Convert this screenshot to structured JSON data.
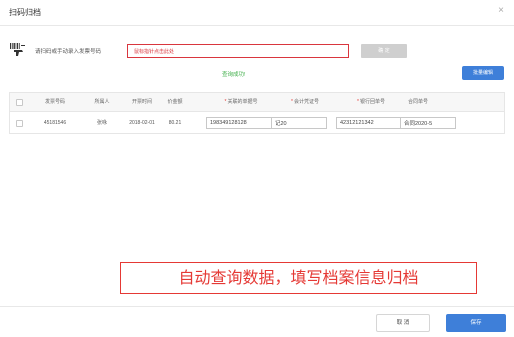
{
  "dialog": {
    "title": "扫码归档",
    "close_glyph": "×"
  },
  "scan": {
    "label": "请扫码或手动录入发票号码",
    "input_value": "鼠标指针点击此处",
    "confirm_label": "确 定"
  },
  "status": {
    "message": "查询成功!",
    "color": "#3fae49"
  },
  "batch_edit_label": "批量编辑",
  "table": {
    "headers": {
      "invoice_no": "发票号码",
      "owner": "所属人",
      "date": "开票时间",
      "amount": "价金额",
      "related_no": "关联的单据号",
      "voucher_no": "会计凭证号",
      "bank_no": "银行回单号",
      "contract_no": "合同单号"
    },
    "row": {
      "invoice_no": "45181546",
      "owner": "张咏",
      "date": "2018-02-01",
      "amount": "80.21",
      "related_no": "198349128128",
      "voucher_no": "记20",
      "bank_no": "42312121342",
      "contract_no": "合同2020-5"
    }
  },
  "annotation": "自动查询数据，填写档案信息归档",
  "footer": {
    "cancel_label": "取 消",
    "save_label": "保存"
  },
  "colors": {
    "primary": "#3e7fd9",
    "danger": "#e53935",
    "success": "#3fae49"
  },
  "icons": {
    "scanner": "barcode-scanner-icon",
    "close": "close-icon"
  }
}
